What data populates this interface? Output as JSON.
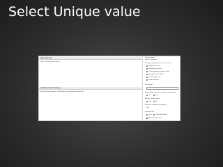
{
  "slide": {
    "title": "Select Unique value"
  },
  "main": {
    "section1": {
      "header": "Name and Type",
      "desc": "Type a name for this column."
    },
    "section2": {
      "header": "Additional Column Settings",
      "desc": "Specify detailed options for the type of information you selected."
    }
  },
  "right": {
    "column_name_label": "Column name:",
    "column_name_value": "Subject / Business",
    "type_label": "The type of information in this column is:",
    "types": [
      {
        "label": "Single line of text",
        "selected": true
      },
      {
        "label": "Multiple lines of text",
        "selected": false
      },
      {
        "label": "Choice (menu to choose from)",
        "selected": false
      },
      {
        "label": "Number (1, 1.0, 100)",
        "selected": false
      },
      {
        "label": "Currency ($, ¥, €)",
        "selected": false
      },
      {
        "label": "Date and Time",
        "selected": false
      }
    ],
    "description_label": "Description:",
    "required_label": "Require that this column contains information:",
    "required_yes": "Yes",
    "required_no": "No",
    "unique_label": "Enforce unique values:",
    "unique_yes": "Yes",
    "unique_no": "No",
    "max_chars_label": "Maximum number of characters:",
    "max_chars_value": "255",
    "default_label": "Default value:",
    "default_option": "Text",
    "default_option2": "Calculated Value",
    "add_to_view": "Add to default view"
  },
  "colors": {
    "accent": "#1a4d8f",
    "header_bg": "#e8edf3"
  }
}
